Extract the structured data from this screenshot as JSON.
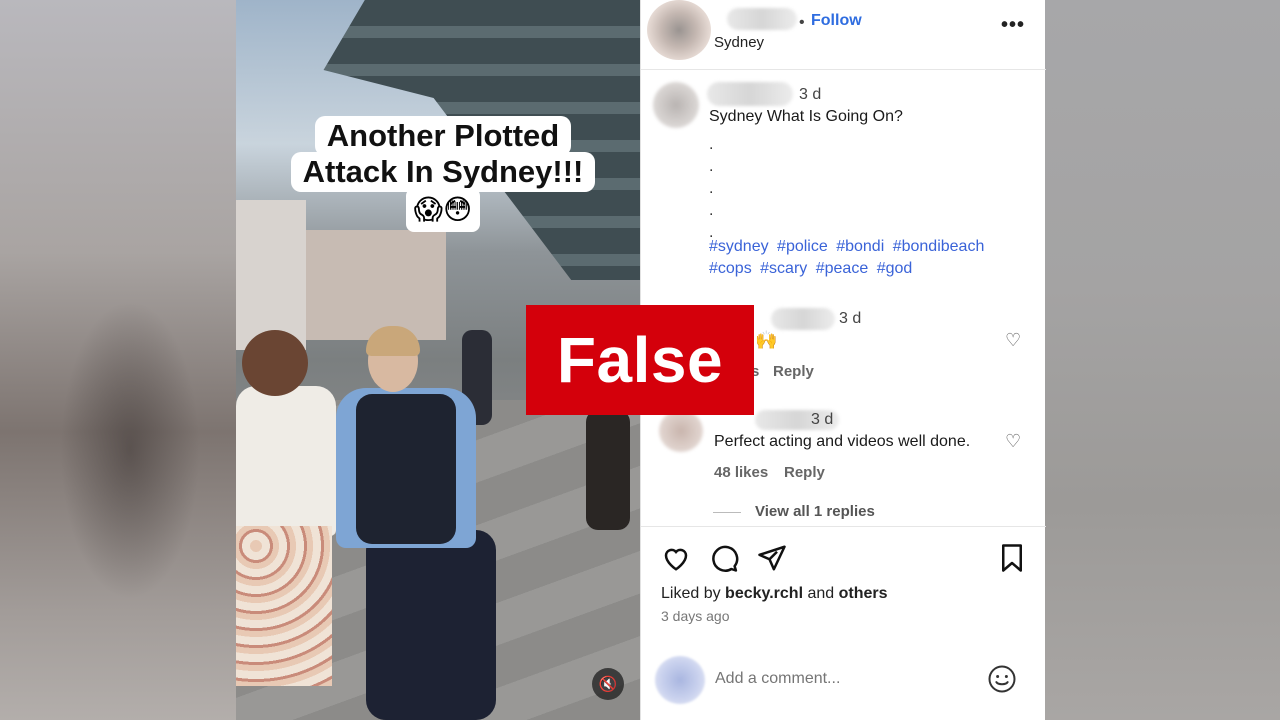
{
  "video": {
    "caption_line1": "Another Plotted",
    "caption_line2": "Attack In Sydney!!!",
    "caption_emoji": "😱😳",
    "mute_icon": "🔇"
  },
  "header": {
    "follow_label": "Follow",
    "location": "Sydney",
    "more_label": "•••"
  },
  "post": {
    "timestamp": "3 d",
    "text": "Sydney What Is Going On?",
    "dots": [
      ".",
      ".",
      ".",
      ".",
      "."
    ],
    "hashtags": [
      "#sydney",
      "#police",
      "#bondi",
      "#bondibeach",
      "#cops",
      "#scary",
      "#peace",
      "#god"
    ]
  },
  "comments": [
    {
      "timestamp": "3 d",
      "text": "🙌",
      "likes_partial": "s",
      "reply_label": "Reply"
    },
    {
      "timestamp": "3 d",
      "text": "Perfect acting and videos well done.",
      "likes": "48 likes",
      "reply_label": "Reply",
      "view_replies": "View all 1 replies"
    }
  ],
  "actions": {
    "liked_by_prefix": "Liked by",
    "liked_by_user": "becky.rchl",
    "liked_by_and": "and",
    "liked_by_others": "others",
    "posted_ago": "3 days ago"
  },
  "add_comment": {
    "placeholder": "Add a comment..."
  },
  "banner": {
    "label": "False",
    "color": "#d4000b"
  },
  "colors": {
    "link_blue": "#3a63d8",
    "follow_blue": "#2f6de0"
  }
}
